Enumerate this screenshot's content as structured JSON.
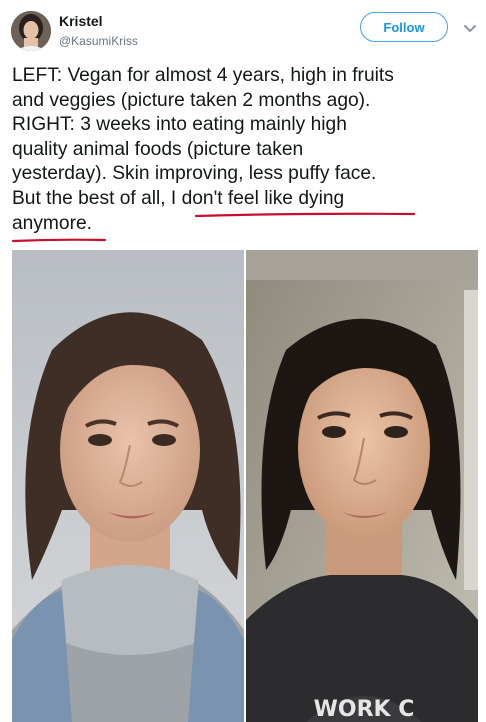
{
  "tweet": {
    "author": {
      "display_name": "Kristel",
      "handle": "@KasumiKriss"
    },
    "follow_label": "Follow",
    "text_lines": [
      "LEFT: Vegan for almost 4 years, high in fruits",
      "and veggies (picture taken 2 months ago).",
      "RIGHT: 3 weeks into eating mainly high",
      "quality animal foods (picture taken",
      "yesterday). Skin improving, less puffy face.",
      "But the best of all, I don't feel like dying",
      "anymore."
    ],
    "underline_color": "#c8102e",
    "accent_color": "#1b95e0",
    "sweater_print": "WORK C"
  }
}
